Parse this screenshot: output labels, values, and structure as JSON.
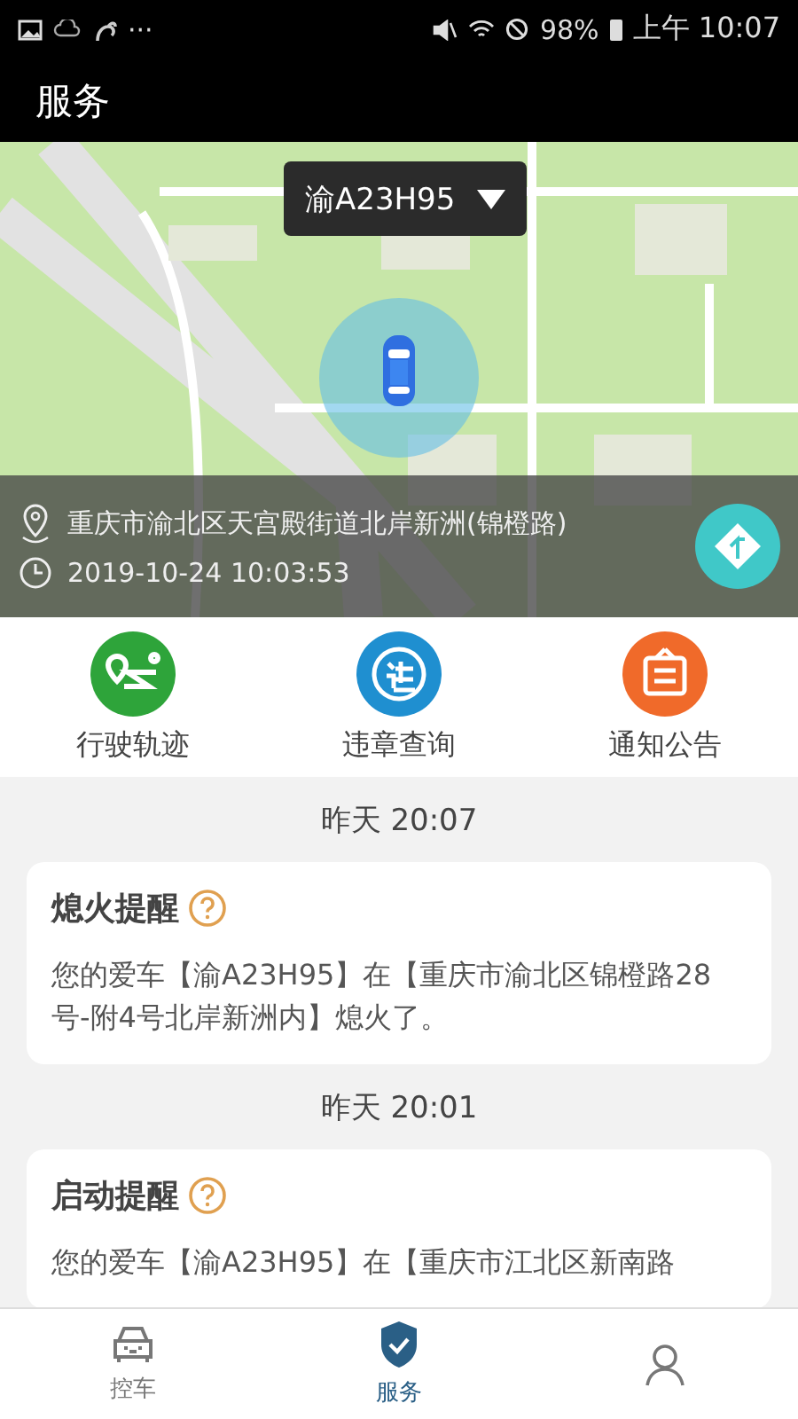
{
  "status_bar": {
    "dots": "···",
    "battery": "98%",
    "time": "上午 10:07"
  },
  "title": "服务",
  "map": {
    "plate": "渝A23H95",
    "address": "重庆市渝北区天宫殿街道北岸新洲(锦橙路)",
    "datetime": "2019-10-24 10:03:53"
  },
  "shortcuts": [
    {
      "kind": "track",
      "label": "行驶轨迹",
      "color": "#2ea43a"
    },
    {
      "kind": "violation",
      "label": "违章查询",
      "color": "#1f8fd0"
    },
    {
      "kind": "notice",
      "label": "通知公告",
      "color": "#f06a2a"
    }
  ],
  "messages": [
    {
      "time": "昨天  20:07",
      "title": "熄火提醒",
      "body": "您的爱车【渝A23H95】在【重庆市渝北区锦橙路28号-附4号北岸新洲内】熄火了。"
    },
    {
      "time": "昨天  20:01",
      "title": "启动提醒",
      "body": "您的爱车【渝A23H95】在【重庆市江北区新南路"
    }
  ],
  "bottom_nav": [
    {
      "kind": "car",
      "label": "控车",
      "selected": false
    },
    {
      "kind": "shield",
      "label": "服务",
      "selected": true
    },
    {
      "kind": "person",
      "selected": false
    }
  ]
}
